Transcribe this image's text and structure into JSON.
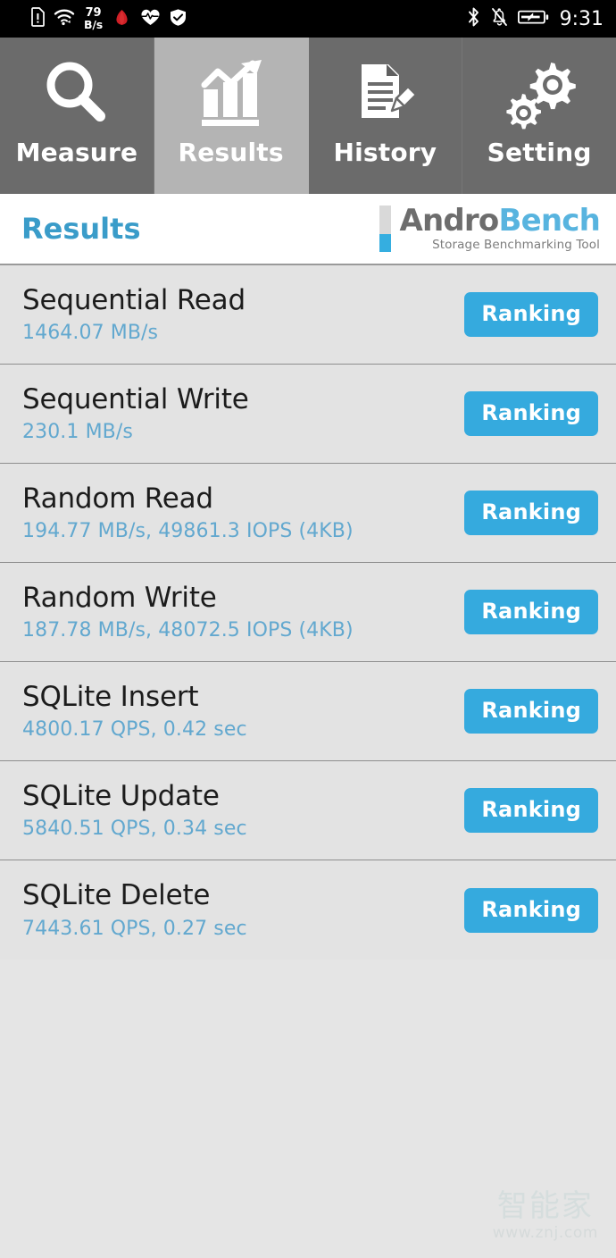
{
  "statusbar": {
    "network_speed_value": "79",
    "network_speed_unit": "B/s",
    "clock": "9:31",
    "left_icons": [
      "sim-card-alert-icon",
      "wifi-icon",
      "network-speed",
      "huawei-logo-icon",
      "heart-rate-icon",
      "shield-check-icon"
    ],
    "right_icons": [
      "bluetooth-icon",
      "notifications-off-icon",
      "battery-charging-icon"
    ]
  },
  "tabs": [
    {
      "label": "Measure",
      "icon": "magnifier-icon",
      "active": false
    },
    {
      "label": "Results",
      "icon": "bar-chart-up-icon",
      "active": true
    },
    {
      "label": "History",
      "icon": "document-pencil-icon",
      "active": false
    },
    {
      "label": "Setting",
      "icon": "gears-icon",
      "active": false
    }
  ],
  "header": {
    "title": "Results",
    "brand_part1": "Andro",
    "brand_part2": "Bench",
    "brand_subtitle": "Storage Benchmarking Tool"
  },
  "results": [
    {
      "name": "Sequential Read",
      "value": "1464.07 MB/s",
      "button": "Ranking"
    },
    {
      "name": "Sequential Write",
      "value": "230.1 MB/s",
      "button": "Ranking"
    },
    {
      "name": "Random Read",
      "value": "194.77 MB/s, 49861.3 IOPS (4KB)",
      "button": "Ranking"
    },
    {
      "name": "Random Write",
      "value": "187.78 MB/s, 48072.5 IOPS (4KB)",
      "button": "Ranking"
    },
    {
      "name": "SQLite Insert",
      "value": "4800.17 QPS, 0.42 sec",
      "button": "Ranking"
    },
    {
      "name": "SQLite Update",
      "value": "5840.51 QPS, 0.34 sec",
      "button": "Ranking"
    },
    {
      "name": "SQLite Delete",
      "value": "7443.61 QPS, 0.27 sec",
      "button": "Ranking"
    }
  ],
  "watermark": {
    "text_cn": "智能家",
    "text_url": "www.znj.com"
  },
  "colors": {
    "accent_blue": "#35aade",
    "title_blue": "#3a9cc9",
    "value_blue": "#62a8cf",
    "tab_inactive": "#6b6b6b",
    "tab_active": "#b4b4b4",
    "row_bg": "#e3e3e3",
    "statusbar_bg": "#000000"
  }
}
